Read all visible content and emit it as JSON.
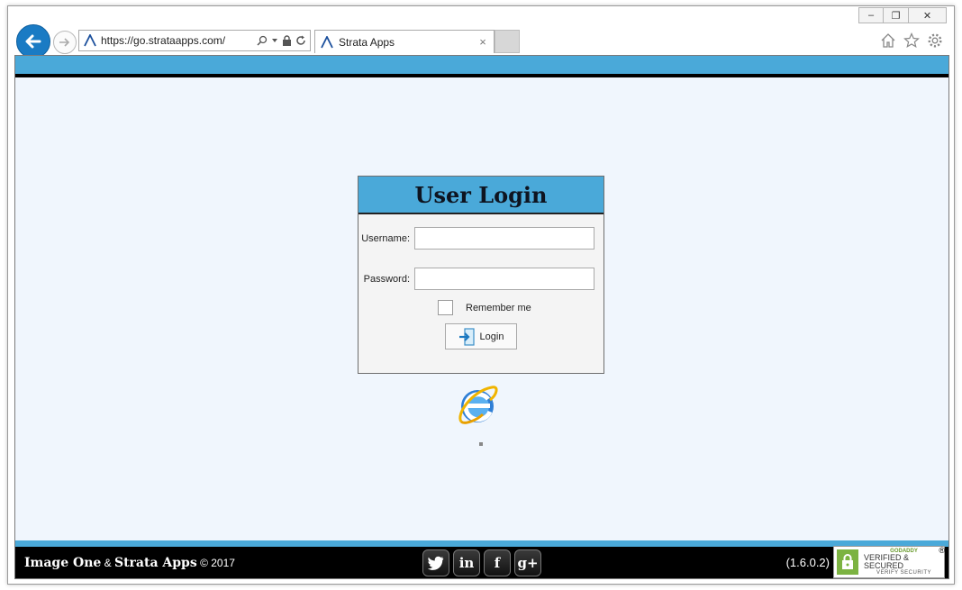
{
  "browser": {
    "url": "https://go.strataapps.com/",
    "tab_title": "Strata Apps",
    "tab_close": "×",
    "caption": {
      "minimize": "–",
      "restore": "❐",
      "close": "✕"
    },
    "accent_color": "#1a7bc4"
  },
  "login": {
    "title": "User Login",
    "username_label": "Username:",
    "username_value": "",
    "password_label": "Password:",
    "password_value": "",
    "remember_label": "Remember me",
    "remember_checked": false,
    "button_label": "Login"
  },
  "footer": {
    "brand1": "Image One",
    "amp": " & ",
    "brand2": "Strata Apps",
    "copyright": " © 2017",
    "version": "(1.6.0.2)",
    "social": [
      "twitter-icon",
      "linkedin-icon",
      "facebook-icon",
      "google-plus-icon"
    ],
    "social_glyphs": {
      "linkedin": "in",
      "facebook": "f",
      "google_plus": "g+"
    },
    "badge": {
      "line1": "GODADDY",
      "line2": "VERIFIED & SECURED",
      "line3": "VERIFY SECURITY",
      "reg": "®"
    }
  },
  "colors": {
    "band": "#4aa9d9",
    "page_bg": "#f0f6fd",
    "footer_bg": "#000000"
  }
}
